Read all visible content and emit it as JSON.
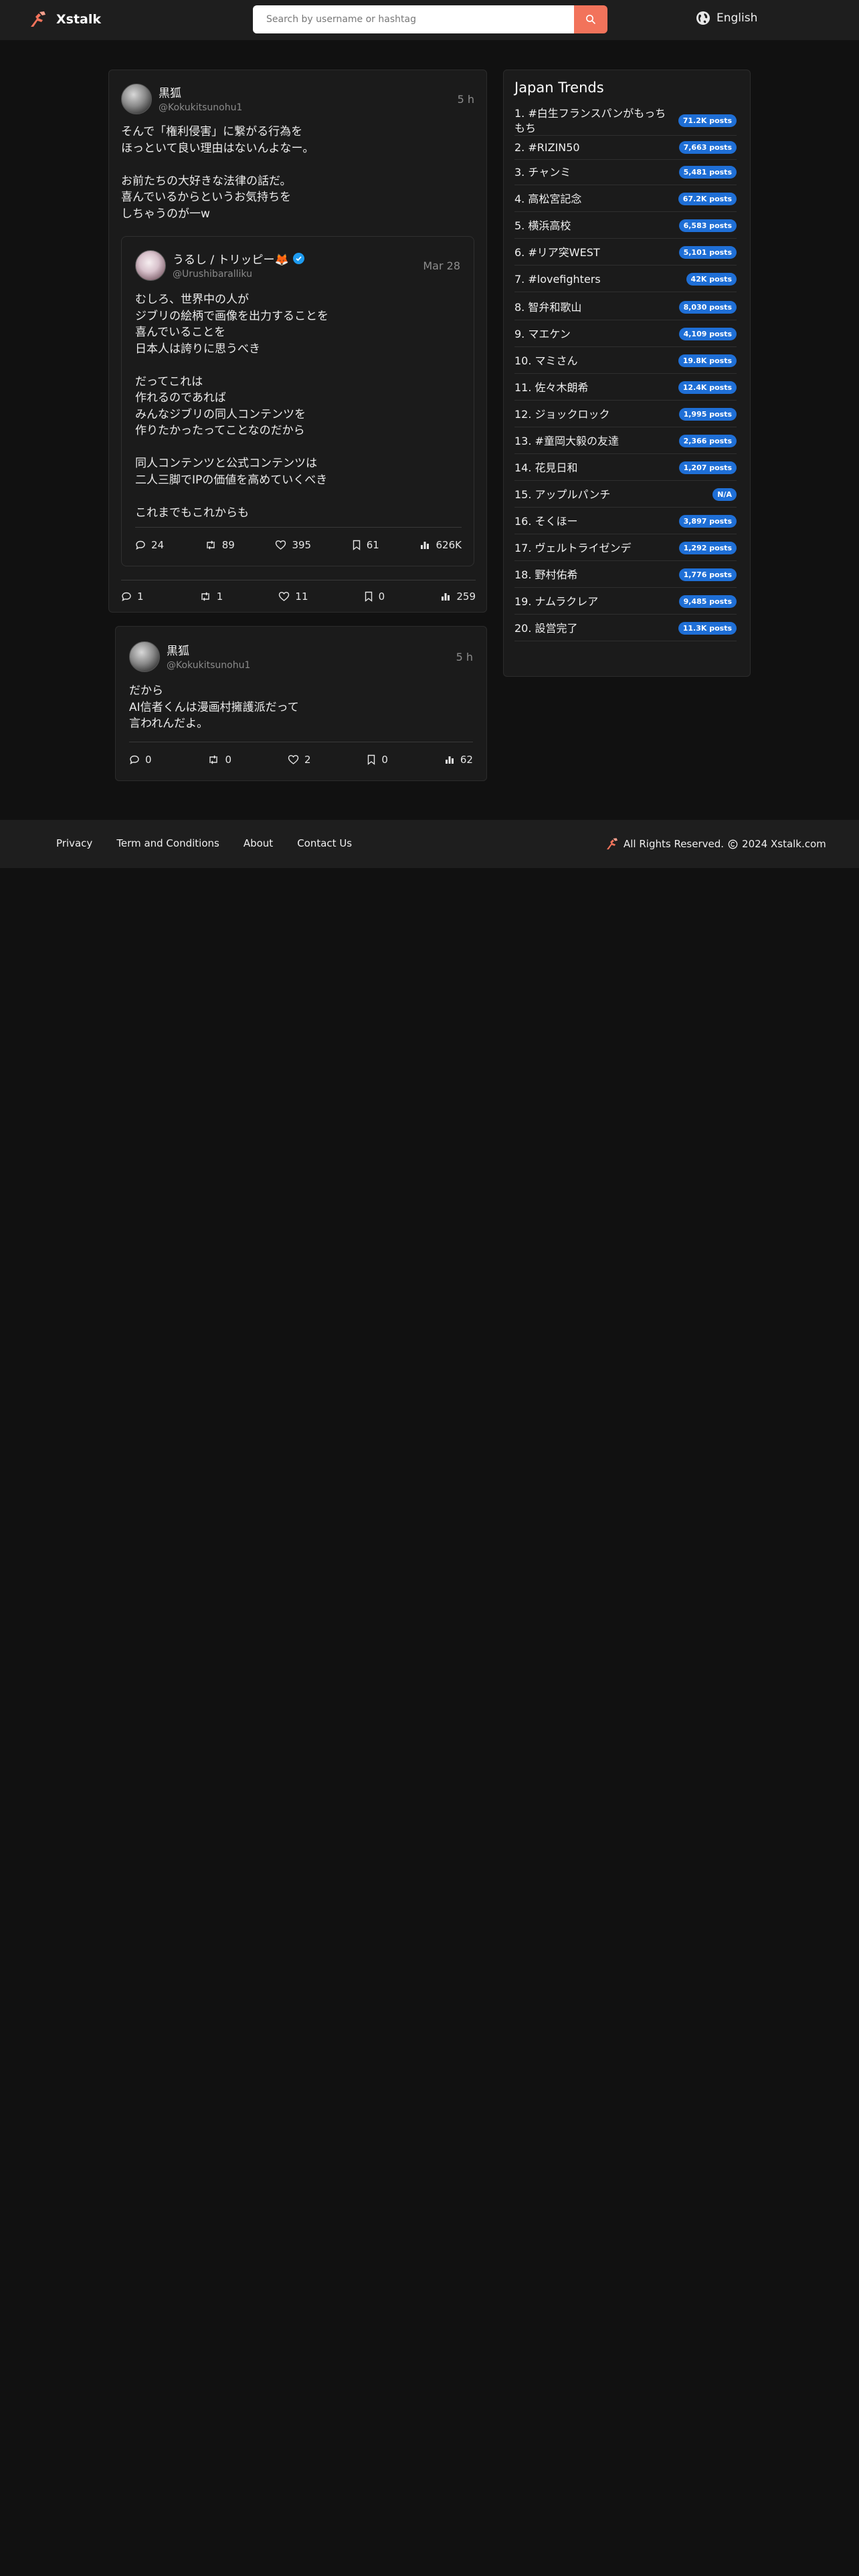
{
  "header": {
    "brand": "Xstalk",
    "search_placeholder": "Search by username or hashtag",
    "language": "English"
  },
  "posts": [
    {
      "display_name": "黒狐",
      "handle": "@Kokukitsunohu1",
      "time": "5 h",
      "text": "そんで「権利侵害」に繋がる行為を\nほっといて良い理由はないんよなー。\n\nお前たちの大好きな法律の話だ。\n喜んでいるからというお気持ちを\nしちゃうのが一w",
      "quote": {
        "display_name": "うるし / トリッピー🦊",
        "handle": "@Urushibaralliku",
        "time": "Mar 28",
        "text": "むしろ、世界中の人が\nジブリの絵柄で画像を出力することを\n喜んでいることを\n日本人は誇りに思うべき\n\nだってこれは\n作れるのであれば\nみんなジブリの同人コンテンツを\n作りたかったってことなのだから\n\n同人コンテンツと公式コンテンツは\n二人三脚でIPの価値を高めていくべき\n\nこれまでもこれからも",
        "replies": "24",
        "retweets": "89",
        "likes": "395",
        "bookmarks": "61",
        "views": "626K"
      },
      "replies": "1",
      "retweets": "1",
      "likes": "11",
      "bookmarks": "0",
      "views": "259"
    },
    {
      "display_name": "黒狐",
      "handle": "@Kokukitsunohu1",
      "time": "5 h",
      "text": "だから\nAI信者くんは漫画村擁護派だって\n言われんだよ。",
      "replies": "0",
      "retweets": "0",
      "likes": "2",
      "bookmarks": "0",
      "views": "62"
    }
  ],
  "trends": {
    "title": "Japan Trends",
    "items": [
      {
        "name": "1. #白生フランスパンがもっちもち",
        "count": "71.2K posts"
      },
      {
        "name": "2. #RIZIN50",
        "count": "7,663 posts"
      },
      {
        "name": "3. チャンミ",
        "count": "5,481 posts"
      },
      {
        "name": "4. 高松宮記念",
        "count": "67.2K posts"
      },
      {
        "name": "5. 横浜高校",
        "count": "6,583 posts"
      },
      {
        "name": "6. #リア突WEST",
        "count": "5,101 posts"
      },
      {
        "name": "7. #lovefighters",
        "count": "42K posts"
      },
      {
        "name": "8. 智弁和歌山",
        "count": "8,030 posts"
      },
      {
        "name": "9. マエケン",
        "count": "4,109 posts"
      },
      {
        "name": "10. マミさん",
        "count": "19.8K posts"
      },
      {
        "name": "11. 佐々木朗希",
        "count": "12.4K posts"
      },
      {
        "name": "12. ジョックロック",
        "count": "1,995 posts"
      },
      {
        "name": "13. #童岡大毅の友達",
        "count": "2,366 posts"
      },
      {
        "name": "14. 花見日和",
        "count": "1,207 posts"
      },
      {
        "name": "15. アップルパンチ",
        "count": "N/A"
      },
      {
        "name": "16. そくほー",
        "count": "3,897 posts"
      },
      {
        "name": "17. ヴェルトライゼンデ",
        "count": "1,292 posts"
      },
      {
        "name": "18. 野村佑希",
        "count": "1,776 posts"
      },
      {
        "name": "19. ナムラクレア",
        "count": "9,485 posts"
      },
      {
        "name": "20. 設営完了",
        "count": "11.3K posts"
      }
    ]
  },
  "footer": {
    "links": [
      "Privacy",
      "Term and Conditions",
      "About",
      "Contact Us"
    ],
    "rights": "All Rights Reserved.",
    "copyright": "2024 Xstalk.com"
  },
  "colors": {
    "accent": "#f2735b",
    "badge": "#1f6fd6",
    "background": "#111111",
    "card": "#1b1b1b"
  }
}
